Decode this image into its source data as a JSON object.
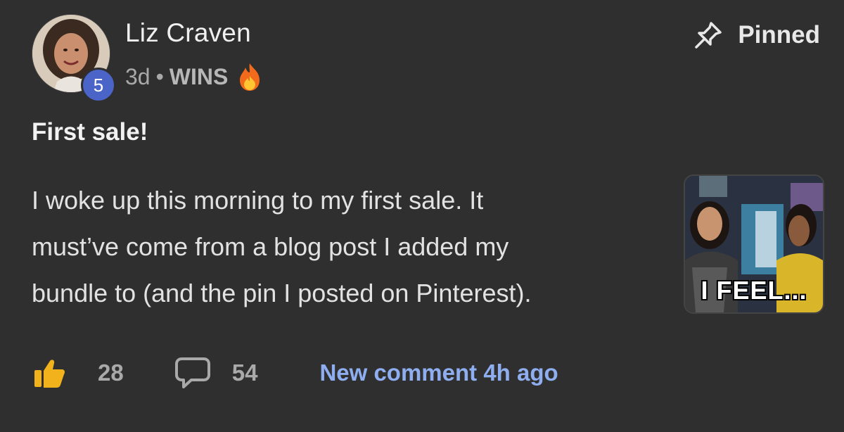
{
  "author": {
    "name": "Liz Craven",
    "level": "5",
    "avatar_icon": "user-photo"
  },
  "meta": {
    "age": "3d",
    "separator": "•",
    "category": "WINS",
    "category_icon": "fire-emoji"
  },
  "pinned": {
    "label": "Pinned",
    "icon": "pin-icon"
  },
  "post": {
    "title": "First sale!",
    "lines": [
      "I woke up this morning to my first sale. It",
      "must’ve come from a blog post I added my",
      "bundle to (and the pin I posted on Pinterest)."
    ],
    "attachment_caption": "I FEEL..."
  },
  "footer": {
    "like_icon": "thumbs-up-icon",
    "like_count": "28",
    "comment_icon": "comment-bubble-icon",
    "comment_count": "54",
    "new_comment": "New comment 4h ago"
  },
  "colors": {
    "background": "#2f2f2f",
    "level_badge": "#4a64c7",
    "link_accent": "#8eaef0",
    "like_icon": "#f2b21b"
  }
}
